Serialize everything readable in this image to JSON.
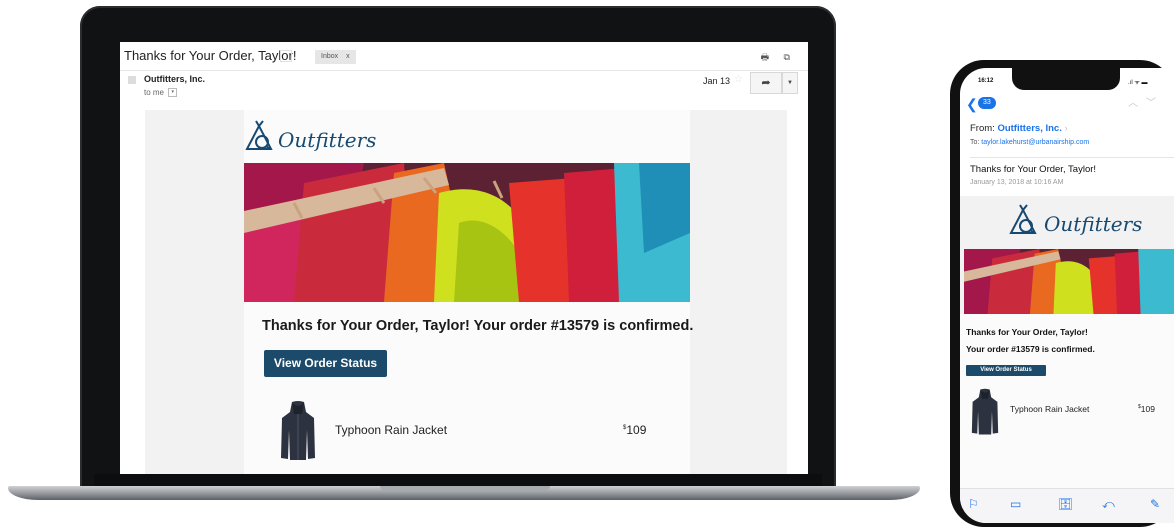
{
  "laptop": {
    "subject": "Thanks for Your Order, Taylor!",
    "inbox_tag": "Inbox",
    "inbox_close": "x",
    "top_icons": "🖶 ⧉",
    "sender": "Outfitters, Inc.",
    "to_me": "to me",
    "date": "Jan 13",
    "reply_icon": "reply-icon",
    "brand": "Outfitters",
    "confirm_title": "Thanks for Your Order, Taylor! Your order #13579 is confirmed.",
    "button": "View Order Status",
    "product_name": "Typhoon Rain Jacket",
    "price_currency": "$",
    "price": "109"
  },
  "phone": {
    "time": "16:12",
    "status": ".ıl ᯤ ▬",
    "back_count": "33",
    "from_label": "From:",
    "from_name": "Outfitters, Inc.",
    "to_label": "To:",
    "to_address": "taylor.lakehurst@urbanairship.com",
    "subject": "Thanks for Your Order, Taylor!",
    "date": "January 13, 2018 at 10:16 AM",
    "brand": "Outfitters",
    "line1": "Thanks for Your Order, Taylor!",
    "line2": "Your order #13579 is confirmed.",
    "button": "View Order Status",
    "product_name": "Typhoon Rain Jacket",
    "price_currency": "$",
    "price": "109"
  },
  "colors": {
    "brand_navy": "#1c4a6a",
    "link_blue": "#1a73e8"
  }
}
